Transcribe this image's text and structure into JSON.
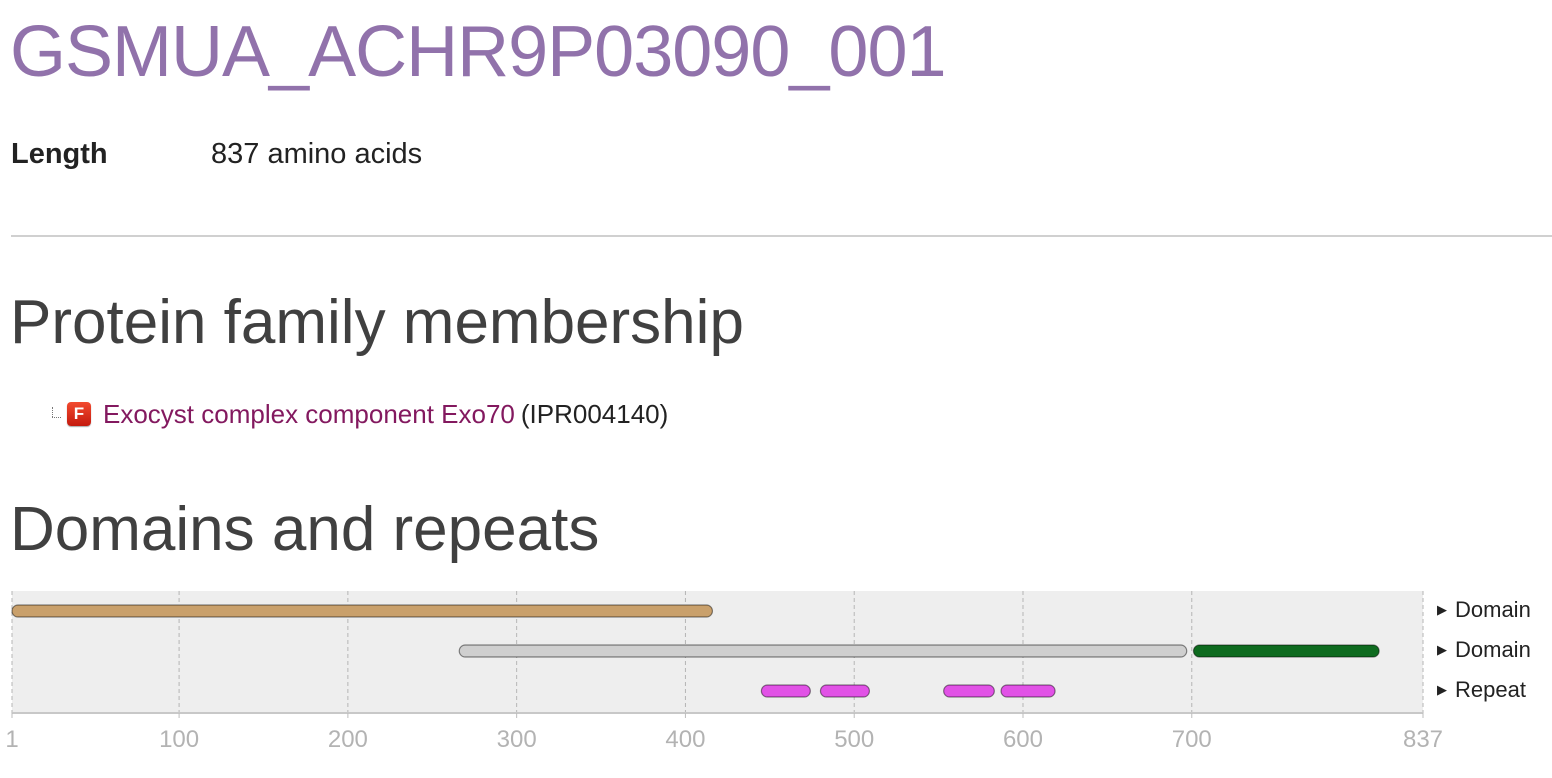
{
  "header": {
    "title": "GSMUA_ACHR9P03090_001"
  },
  "summary": {
    "length_label": "Length",
    "length_value": "837 amino acids"
  },
  "family_section": {
    "heading": "Protein family membership",
    "entries": [
      {
        "badge": "F",
        "name": "Exocyst complex component Exo70",
        "accession": "(IPR004140)"
      }
    ]
  },
  "domains_section": {
    "heading": "Domains and repeats",
    "track_labels": [
      "Domain",
      "Domain",
      "Repeat"
    ]
  },
  "chart_data": {
    "type": "feature-track",
    "xlim": [
      1,
      837
    ],
    "ticks": [
      1,
      100,
      200,
      300,
      400,
      500,
      600,
      700,
      837
    ],
    "grid": true,
    "tracks": [
      {
        "label": "Domain",
        "features": [
          {
            "start": 1,
            "end": 416,
            "color": "#c9a06b"
          }
        ]
      },
      {
        "label": "Domain",
        "features": [
          {
            "start": 266,
            "end": 697,
            "color": "#cfcfcf"
          },
          {
            "start": 701,
            "end": 811,
            "color": "#0e6b1f"
          }
        ]
      },
      {
        "label": "Repeat",
        "features": [
          {
            "start": 445,
            "end": 474,
            "color": "#e152e6"
          },
          {
            "start": 480,
            "end": 509,
            "color": "#e152e6"
          },
          {
            "start": 553,
            "end": 583,
            "color": "#e152e6"
          },
          {
            "start": 587,
            "end": 619,
            "color": "#e152e6"
          }
        ]
      }
    ]
  }
}
